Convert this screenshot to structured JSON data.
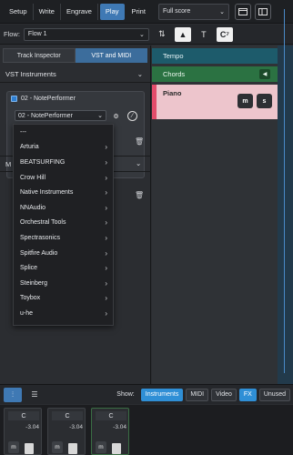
{
  "topbar": {
    "modes": [
      "Setup",
      "Write",
      "Engrave",
      "Play",
      "Print"
    ],
    "active_mode": "Play",
    "layout_value": "Full score"
  },
  "flowbar": {
    "label": "Flow:",
    "flow_value": "Flow 1",
    "chord_tool_label": "C⁷"
  },
  "leftpanel": {
    "tabs": [
      "Track Inspector",
      "VST and MIDI"
    ],
    "active_tab": "VST and MIDI",
    "section_title": "VST Instruments",
    "instrument_title": "02 - NotePerformer",
    "instrument_select": "02 - NotePerformer",
    "hidden_section_letter": "M"
  },
  "dropdown": {
    "items": [
      {
        "label": "---",
        "submenu": false
      },
      {
        "label": "Arturia",
        "submenu": true
      },
      {
        "label": "BEATSURFING",
        "submenu": true
      },
      {
        "label": "Crow Hill",
        "submenu": true
      },
      {
        "label": "Native Instruments",
        "submenu": true
      },
      {
        "label": "NNAudio",
        "submenu": true
      },
      {
        "label": "Orchestral Tools",
        "submenu": true
      },
      {
        "label": "Spectrasonics",
        "submenu": true
      },
      {
        "label": "Spitfire Audio",
        "submenu": true
      },
      {
        "label": "Splice",
        "submenu": true
      },
      {
        "label": "Steinberg",
        "submenu": true
      },
      {
        "label": "Toybox",
        "submenu": true
      },
      {
        "label": "u-he",
        "submenu": true
      }
    ]
  },
  "tracks": {
    "tempo": "Tempo",
    "chords": "Chords",
    "piano": "Piano",
    "mute": "m",
    "solo": "s"
  },
  "mixer": {
    "show_label": "Show:",
    "filters": [
      {
        "label": "Instruments",
        "active": true
      },
      {
        "label": "MIDI",
        "active": false
      },
      {
        "label": "Video",
        "active": false
      },
      {
        "label": "FX",
        "active": true
      },
      {
        "label": "Unused",
        "active": false
      }
    ],
    "channels": [
      {
        "pan": "C",
        "level": "-3.04",
        "mute": "m"
      },
      {
        "pan": "C",
        "level": "-3.04",
        "mute": "m"
      },
      {
        "pan": "C",
        "level": "-3.04",
        "mute": "m"
      }
    ]
  },
  "colors": {
    "accent": "#3f79b4",
    "tempo": "#1d5b6b",
    "chords": "#2b7242",
    "piano": "#edc5cc",
    "piano_strip": "#e24d6b"
  }
}
